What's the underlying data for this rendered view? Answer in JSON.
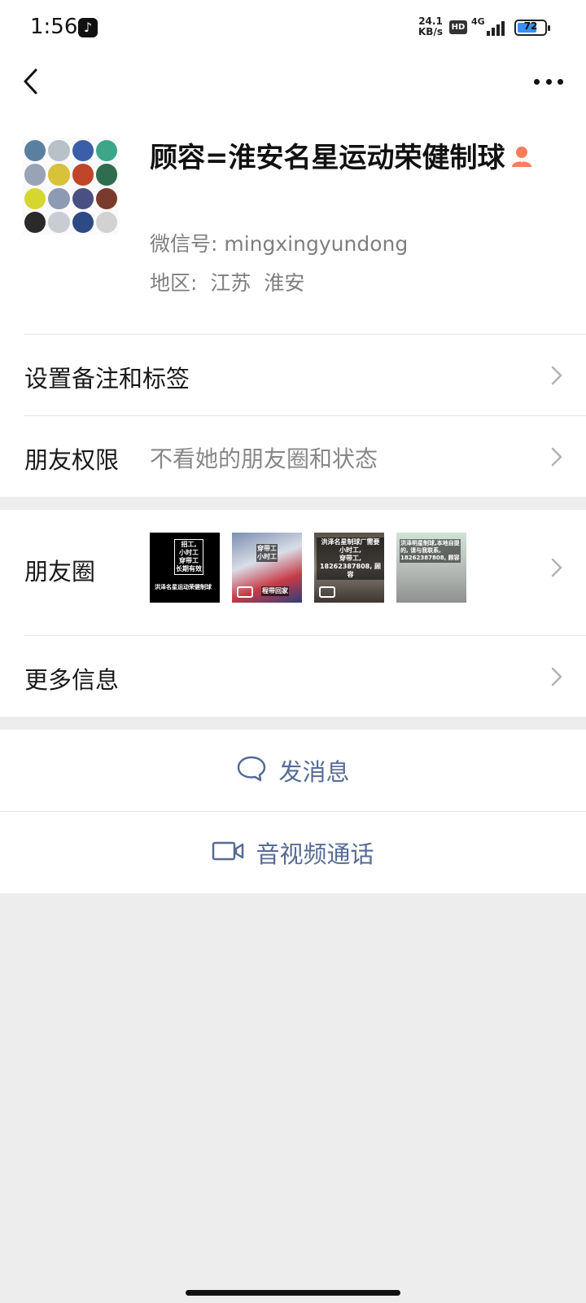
{
  "status_bar": {
    "time": "1:56",
    "net_speed_value": "24.1",
    "net_speed_unit": "KB/s",
    "hd": "HD",
    "network": "4G",
    "battery": "72",
    "battery_level_percent": 72
  },
  "nav": {
    "back_icon": "chevron-left-icon",
    "more_icon": "more-dots-icon"
  },
  "profile": {
    "name": "顾容=淮安名星运动荣健制球",
    "wechat_id": "微信号: mingxingyundong",
    "region": "地区: 江苏 淮安",
    "contact_type_icon": "person-icon"
  },
  "settings": {
    "remark_label": "设置备注和标签",
    "permission_label": "朋友权限",
    "permission_value": "不看她的朋友圈和状态"
  },
  "moments": {
    "label": "朋友圈",
    "thumbs": [
      {
        "lines": [
          "招工,",
          "小时工",
          "穿带工",
          "长期有效"
        ],
        "bottom": "洪泽名星运动荣健制球"
      },
      {
        "lines": [
          "穿带工",
          "小时工"
        ],
        "bottom": "程带回家"
      },
      {
        "lines": [
          "洪泽名星制球厂需要",
          "小时工,",
          "穿带工,",
          "18262387808, 顾容"
        ],
        "bottom": ""
      },
      {
        "lines": [
          "洪泽明星制球,本地自提",
          "的, 请与我联系,",
          "18262387808, 顾容"
        ],
        "bottom": ""
      }
    ]
  },
  "more_info": {
    "label": "更多信息"
  },
  "actions": {
    "message": "发消息",
    "call": "音视频通话"
  },
  "colors": {
    "link_blue": "#576b95",
    "page_bg": "#ededed",
    "person_icon": "#fa7d5b"
  }
}
